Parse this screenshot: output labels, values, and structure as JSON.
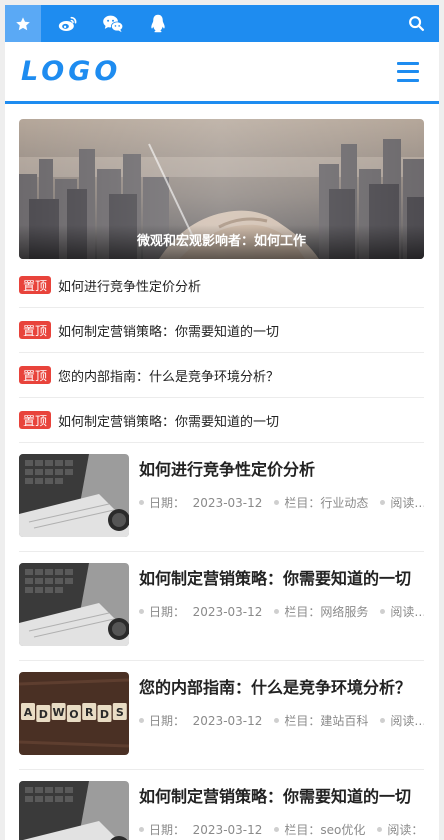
{
  "topbar": {
    "icons": [
      "star-icon",
      "weibo-icon",
      "wechat-icon",
      "qq-icon"
    ],
    "search_icon": "search-icon",
    "accent": "#1e8cf0"
  },
  "header": {
    "logo": "LOGO",
    "menu_icon": "menu-icon"
  },
  "hero": {
    "caption": "微观和宏观影响者：如何工作"
  },
  "pinned": {
    "badge": "置顶",
    "items": [
      "如何进行竞争性定价分析",
      "如何制定营销策略：你需要知道的一切",
      "您的内部指南：什么是竞争环境分析？",
      "如何制定营销策略：你需要知道的一切"
    ]
  },
  "articles": [
    {
      "title": "如何进行竞争性定价分析",
      "date_label": "日期：",
      "date": "2023-03-12",
      "cat": "栏目：行业动态",
      "read": "阅读…"
    },
    {
      "title": "如何制定营销策略：你需要知道的一切",
      "date_label": "日期：",
      "date": "2023-03-12",
      "cat": "栏目：网络服务",
      "read": "阅读…"
    },
    {
      "title": "您的内部指南：什么是竞争环境分析？",
      "date_label": "日期：",
      "date": "2023-03-12",
      "cat": "栏目：建站百科",
      "read": "阅读…"
    },
    {
      "title": "如何制定营销策略：你需要知道的一切",
      "date_label": "日期：",
      "date": "2023-03-12",
      "cat": "栏目：seo优化",
      "read": "阅读：…"
    }
  ],
  "adwords_letters": [
    "A",
    "D",
    "W",
    "O",
    "R",
    "D",
    "S"
  ]
}
